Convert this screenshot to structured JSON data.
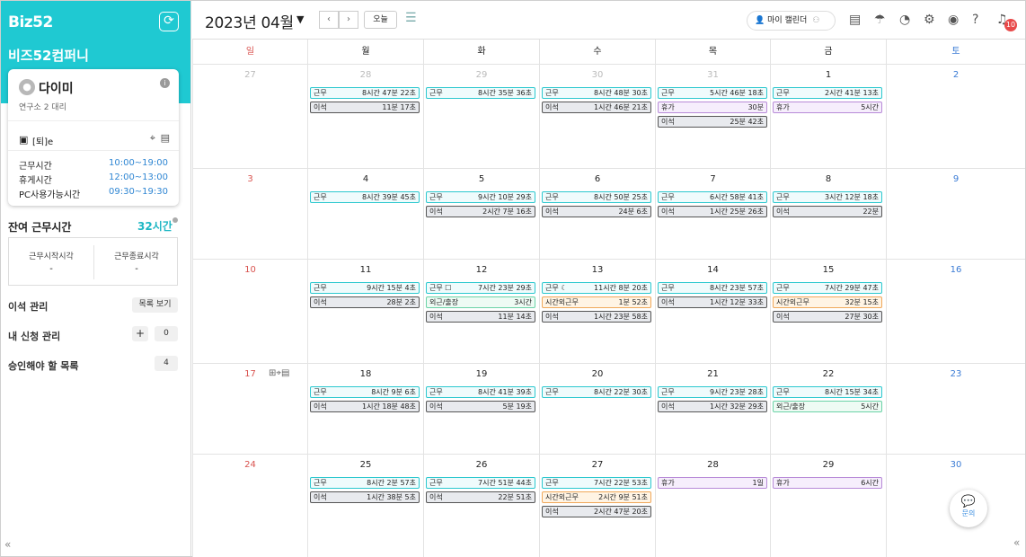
{
  "sidebar": {
    "logo": "Biz52",
    "company": "비즈52컴퍼니",
    "user": {
      "name": "다이미",
      "dept": "연구소 2 대리",
      "device": "[퇴]e"
    },
    "times": [
      {
        "label": "근무시간",
        "value": "10:00~19:00"
      },
      {
        "label": "휴게시간",
        "value": "12:00~13:00"
      },
      {
        "label": "PC사용가능시간",
        "value": "09:30~19:30"
      }
    ],
    "remain_label": "잔여 근무시간",
    "remain_value": "32시간",
    "start_label": "근무시작시각",
    "end_label": "근무종료시각",
    "start_value": "-",
    "end_value": "-",
    "away_label": "이석 관리",
    "away_btn": "목록 보기",
    "req_label": "내 신청 관리",
    "req_count": "0",
    "approve_label": "승인해야 할 목록",
    "approve_count": "4"
  },
  "header": {
    "month": "2023년 04월",
    "today": "오늘",
    "my_calendar": "마이 캘린더",
    "notif_count": "10"
  },
  "weekdays": [
    "일",
    "월",
    "화",
    "수",
    "목",
    "금",
    "토"
  ],
  "chat_label": "문의",
  "colors": {
    "accent": "#1fc9d2",
    "sunday": "#d9534f",
    "saturday": "#3a7bd5"
  },
  "weeks": [
    [
      {
        "d": "27",
        "other": true,
        "ev": []
      },
      {
        "d": "28",
        "other": true,
        "ev": [
          [
            "work",
            "근무",
            "8시간 47분 22초"
          ],
          [
            "away",
            "이석",
            "11분 17초"
          ]
        ]
      },
      {
        "d": "29",
        "other": true,
        "ev": [
          [
            "work",
            "근무",
            "8시간 35분 36초"
          ]
        ]
      },
      {
        "d": "30",
        "other": true,
        "ev": [
          [
            "work",
            "근무",
            "8시간 48분 30초"
          ],
          [
            "away",
            "이석",
            "1시간 46분 21초"
          ]
        ]
      },
      {
        "d": "31",
        "other": true,
        "ev": [
          [
            "work",
            "근무",
            "5시간 46분 18초"
          ],
          [
            "leave",
            "휴가",
            "30분"
          ],
          [
            "away",
            "이석",
            "25분 42초"
          ]
        ]
      },
      {
        "d": "1",
        "ev": [
          [
            "work",
            "근무",
            "2시간 41분 13초"
          ],
          [
            "leave",
            "휴가",
            "5시간"
          ]
        ]
      },
      {
        "d": "2",
        "ev": []
      }
    ],
    [
      {
        "d": "3",
        "ev": []
      },
      {
        "d": "4",
        "ev": [
          [
            "work",
            "근무",
            "8시간 39분 45초"
          ]
        ]
      },
      {
        "d": "5",
        "ev": [
          [
            "work",
            "근무",
            "9시간 10분 29초"
          ],
          [
            "away",
            "이석",
            "2시간 7분 16초"
          ]
        ]
      },
      {
        "d": "6",
        "ev": [
          [
            "work",
            "근무",
            "8시간 50분 25초"
          ],
          [
            "away",
            "이석",
            "24분 6초"
          ]
        ]
      },
      {
        "d": "7",
        "ev": [
          [
            "work",
            "근무",
            "6시간 58분 41초"
          ],
          [
            "away",
            "이석",
            "1시간 25분 26초"
          ]
        ]
      },
      {
        "d": "8",
        "ev": [
          [
            "work",
            "근무",
            "3시간 12분 18초"
          ],
          [
            "away",
            "이석",
            "22분"
          ]
        ]
      },
      {
        "d": "9",
        "ev": []
      }
    ],
    [
      {
        "d": "10",
        "ev": []
      },
      {
        "d": "11",
        "ev": [
          [
            "work",
            "근무",
            "9시간 15분 4초"
          ],
          [
            "away",
            "이석",
            "28분 2초"
          ]
        ]
      },
      {
        "d": "12",
        "ev": [
          [
            "work",
            "근무 ☐",
            "7시간 23분 29초"
          ],
          [
            "biz",
            "외근/출장",
            "3시간"
          ],
          [
            "away",
            "이석",
            "11분 14초"
          ]
        ]
      },
      {
        "d": "13",
        "ev": [
          [
            "work",
            "근무 ☾",
            "11시간 8분 20초"
          ],
          [
            "over",
            "시간외근무",
            "1분 52초"
          ],
          [
            "away",
            "이석",
            "1시간 23분 58초"
          ]
        ]
      },
      {
        "d": "14",
        "ev": [
          [
            "work",
            "근무",
            "8시간 23분 57초"
          ],
          [
            "away",
            "이석",
            "1시간 12분 33초"
          ]
        ]
      },
      {
        "d": "15",
        "ev": [
          [
            "work",
            "근무",
            "7시간 29분 47초"
          ],
          [
            "over",
            "시간외근무",
            "32분 15초"
          ],
          [
            "away",
            "이석",
            "27분 30초"
          ]
        ]
      },
      {
        "d": "16",
        "ev": []
      }
    ],
    [
      {
        "d": "17",
        "icons": true,
        "ev": []
      },
      {
        "d": "18",
        "ev": [
          [
            "work",
            "근무",
            "8시간 9분 6초"
          ],
          [
            "away",
            "이석",
            "1시간 18분 48초"
          ]
        ]
      },
      {
        "d": "19",
        "ev": [
          [
            "work",
            "근무",
            "8시간 41분 39초"
          ],
          [
            "away",
            "이석",
            "5분 19초"
          ]
        ]
      },
      {
        "d": "20",
        "ev": [
          [
            "work",
            "근무",
            "8시간 22분 30초"
          ]
        ]
      },
      {
        "d": "21",
        "ev": [
          [
            "work",
            "근무",
            "9시간 23분 28초"
          ],
          [
            "away",
            "이석",
            "1시간 32분 29초"
          ]
        ]
      },
      {
        "d": "22",
        "ev": [
          [
            "work",
            "근무",
            "8시간 15분 34초"
          ],
          [
            "biz",
            "외근/출장",
            "5시간"
          ]
        ]
      },
      {
        "d": "23",
        "ev": []
      }
    ],
    [
      {
        "d": "24",
        "ev": []
      },
      {
        "d": "25",
        "ev": [
          [
            "work",
            "근무",
            "8시간 2분 57초"
          ],
          [
            "away",
            "이석",
            "1시간 38분 5초"
          ]
        ]
      },
      {
        "d": "26",
        "ev": [
          [
            "work",
            "근무",
            "7시간 51분 44초"
          ],
          [
            "away",
            "이석",
            "22분 51초"
          ]
        ]
      },
      {
        "d": "27",
        "ev": [
          [
            "work",
            "근무",
            "7시간 22분 53초"
          ],
          [
            "over",
            "시간외근무",
            "2시간 9분 51초"
          ],
          [
            "away",
            "이석",
            "2시간 47분 20초"
          ]
        ]
      },
      {
        "d": "28",
        "ev": [
          [
            "leave",
            "휴가",
            "1일"
          ]
        ]
      },
      {
        "d": "29",
        "ev": [
          [
            "leave",
            "휴가",
            "6시간"
          ]
        ]
      },
      {
        "d": "30",
        "ev": []
      }
    ]
  ]
}
